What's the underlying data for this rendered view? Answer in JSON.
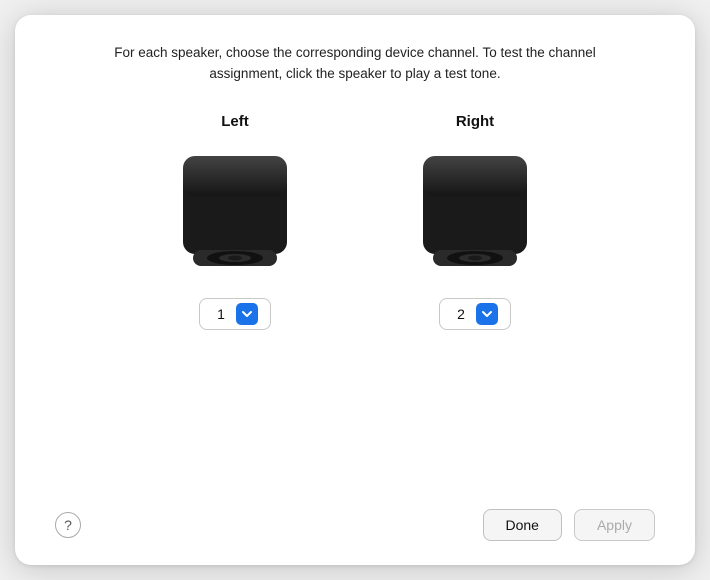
{
  "dialog": {
    "description": "For each speaker, choose the corresponding device channel. To test the channel assignment, click the speaker to play a test tone.",
    "left_label": "Left",
    "right_label": "Right",
    "left_channel": "1",
    "right_channel": "2",
    "help_label": "?",
    "done_label": "Done",
    "apply_label": "Apply"
  }
}
